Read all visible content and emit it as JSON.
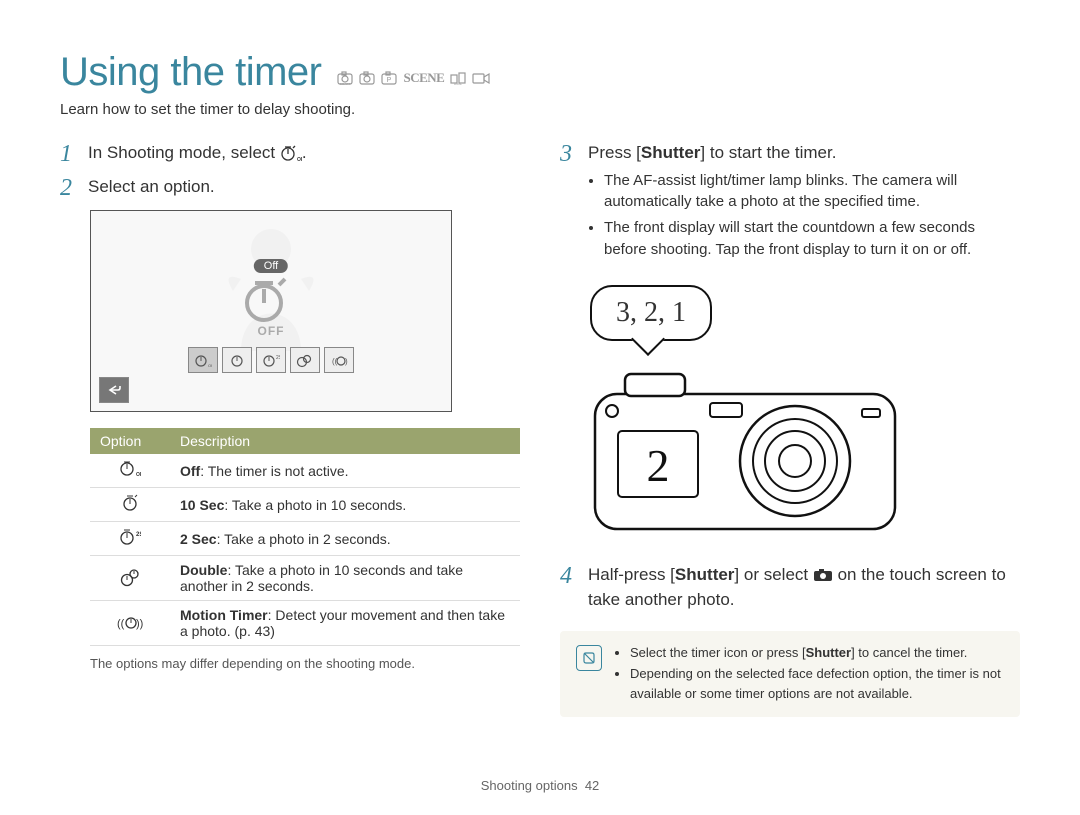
{
  "title": "Using the timer",
  "mode_icons": [
    "smart-icon",
    "auto-icon",
    "program-icon",
    "scene-icon",
    "dual-icon",
    "movie-icon"
  ],
  "subtitle": "Learn how to set the timer to delay shooting.",
  "left": {
    "step1_num": "1",
    "step1_text_a": "In Shooting mode, select ",
    "step1_text_b": ".",
    "step2_num": "2",
    "step2_text": "Select an option.",
    "screen_label": "Off",
    "big_icon_sub": "OFF",
    "table_header_option": "Option",
    "table_header_description": "Description",
    "rows": [
      {
        "icon": "timer-off-icon",
        "bold": "Off",
        "rest": ": The timer is not active."
      },
      {
        "icon": "timer-10s-icon",
        "bold": "10 Sec",
        "rest": ": Take a photo in 10 seconds."
      },
      {
        "icon": "timer-2s-icon",
        "bold": "2 Sec",
        "rest": ": Take a photo in 2 seconds."
      },
      {
        "icon": "timer-double-icon",
        "bold": "Double",
        "rest": ": Take a photo in 10 seconds and take another in 2 seconds."
      },
      {
        "icon": "timer-motion-icon",
        "bold": "Motion Timer",
        "rest": ": Detect your movement and then take a photo. (p. 43)"
      }
    ],
    "footnote": "The options may differ depending on the shooting mode."
  },
  "right": {
    "step3_num": "3",
    "step3_text_a": "Press [",
    "step3_text_b": "Shutter",
    "step3_text_c": "] to start the timer.",
    "step3_bullets": [
      "The AF-assist light/timer lamp blinks. The camera will automatically take a photo at the specified time.",
      "The front display will start the countdown a few seconds before shooting. Tap the front display to turn it on or off."
    ],
    "speech_text": "3, 2, 1",
    "front_display_count": "2",
    "step4_num": "4",
    "step4_text_a": "Half-press [",
    "step4_text_b": "Shutter",
    "step4_text_c": "] or select ",
    "step4_text_d": " on the touch screen to take another photo.",
    "note_bullets_a": "Select the timer icon or press [",
    "note_bullets_b": "Shutter",
    "note_bullets_c": "] to cancel the timer.",
    "note_bullets_2": "Depending on the selected face defection option, the timer is not available or some timer options are not available."
  },
  "footer_label": "Shooting options",
  "footer_page": "42"
}
